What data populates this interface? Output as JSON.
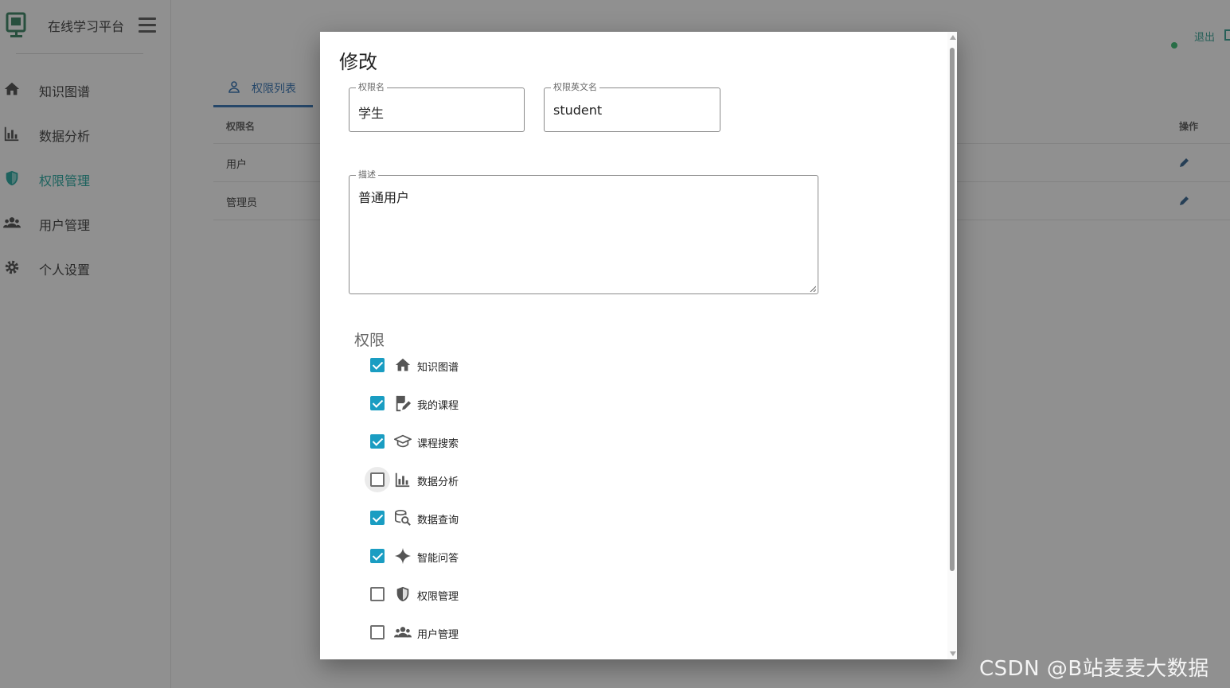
{
  "app": {
    "title": "在线学习平台"
  },
  "sidebar": {
    "items": [
      {
        "label": "知识图谱",
        "icon": "home-icon"
      },
      {
        "label": "数据分析",
        "icon": "bar-chart-icon"
      },
      {
        "label": "权限管理",
        "icon": "shield-icon",
        "active": true
      },
      {
        "label": "用户管理",
        "icon": "users-icon"
      },
      {
        "label": "个人设置",
        "icon": "gear-icon"
      }
    ]
  },
  "topbar": {
    "logout_label": "退出"
  },
  "page": {
    "tab_label": "权限列表",
    "table": {
      "headers": {
        "name": "权限名",
        "actions": "操作"
      },
      "rows": [
        {
          "name": "用户"
        },
        {
          "name": "管理员"
        }
      ]
    }
  },
  "dialog": {
    "title": "修改",
    "fields": {
      "name": {
        "label": "权限名",
        "value": "学生"
      },
      "en_name": {
        "label": "权限英文名",
        "value": "student"
      },
      "description": {
        "label": "描述",
        "value": "普通用户"
      }
    },
    "permissions_heading": "权限",
    "permissions": [
      {
        "label": "知识图谱",
        "checked": true,
        "icon": "home-icon"
      },
      {
        "label": "我的课程",
        "checked": true,
        "icon": "book-edit-icon"
      },
      {
        "label": "课程搜索",
        "checked": true,
        "icon": "graduation-cap-icon"
      },
      {
        "label": "数据分析",
        "checked": false,
        "icon": "bar-chart-icon"
      },
      {
        "label": "数据查询",
        "checked": true,
        "icon": "database-search-icon"
      },
      {
        "label": "智能问答",
        "checked": true,
        "icon": "sparkle-icon"
      },
      {
        "label": "权限管理",
        "checked": false,
        "icon": "shield-icon"
      },
      {
        "label": "用户管理",
        "checked": false,
        "icon": "users-icon"
      }
    ]
  },
  "watermark": {
    "footer": "CSDN @B站麦麦大数据"
  },
  "colors": {
    "accent": "#18a39a",
    "checkbox": "#1a9dc2",
    "link": "#2b6cb0"
  }
}
